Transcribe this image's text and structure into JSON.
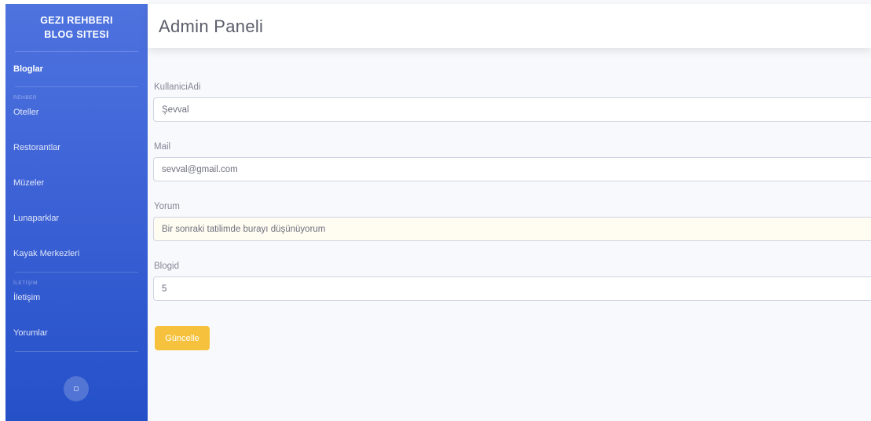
{
  "sidebar": {
    "brand_line1": "GEZI REHBERI",
    "brand_line2": "BLOG SITESI",
    "blogs": "Bloglar",
    "section_rehber": "REHBER",
    "items_rehber": [
      "Oteller",
      "Restorantlar",
      "Müzeler",
      "Lunaparklar",
      "Kayak Merkezleri"
    ],
    "section_iletisim": "İLETİŞİM",
    "items_iletisim": [
      "İletişim",
      "Yorumlar"
    ]
  },
  "header": {
    "title": "Admin Paneli"
  },
  "form": {
    "username_label": "KullaniciAdi",
    "username_value": "Şevval",
    "mail_label": "Mail",
    "mail_value": "sevval@gmail.com",
    "comment_label": "Yorum",
    "comment_value": "Bir sonraki tatilimde burayı düşünüyorum",
    "blogid_label": "Blogid",
    "blogid_value": "5",
    "submit_label": "Güncelle"
  },
  "colors": {
    "sidebar_top": "#4e73df",
    "sidebar_bottom": "#2450c8",
    "button": "#f6c23e"
  },
  "icons": {
    "sidebar_toggle": "sidebar-toggle-icon"
  }
}
